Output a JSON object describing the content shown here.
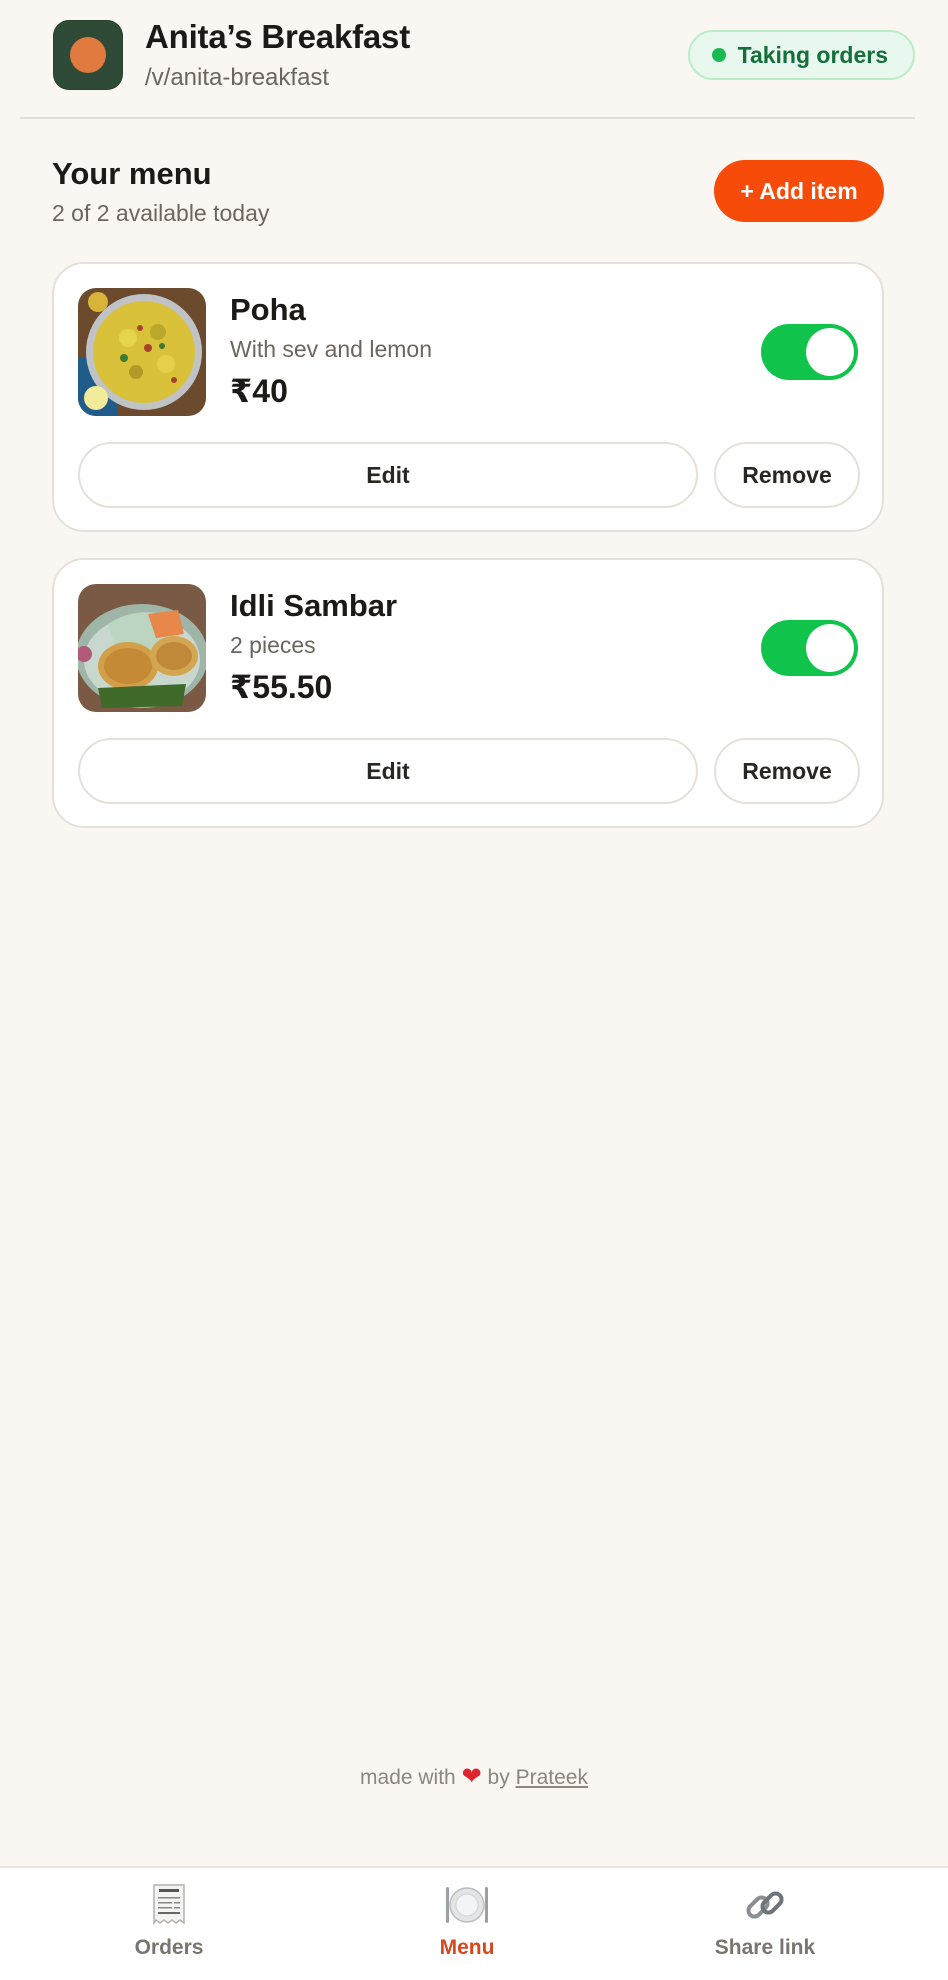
{
  "header": {
    "shop_name": "Anita’s Breakfast",
    "slug": "/v/anita-breakfast",
    "status_label": "Taking orders"
  },
  "menu": {
    "title": "Your menu",
    "subtitle": "2 of 2 available today",
    "add_label": "+ Add item",
    "items": [
      {
        "name": "Poha",
        "description": "With sev and lemon",
        "price": "₹40",
        "available": true,
        "image_icon": "poha-photo",
        "edit_label": "Edit",
        "remove_label": "Remove"
      },
      {
        "name": "Idli Sambar",
        "description": "2 pieces",
        "price": "₹55.50",
        "available": true,
        "image_icon": "idli-sambar-photo",
        "edit_label": "Edit",
        "remove_label": "Remove"
      }
    ]
  },
  "footer": {
    "credit_prefix": "made with",
    "credit_middle": "by",
    "credit_author": "Prateek"
  },
  "nav": {
    "items": [
      {
        "label": "Orders",
        "icon": "receipt-icon",
        "active": false
      },
      {
        "label": "Menu",
        "icon": "plate-icon",
        "active": true
      },
      {
        "label": "Share link",
        "icon": "link-icon",
        "active": false
      }
    ]
  },
  "colors": {
    "accent": "#f74b0a",
    "toggle_on": "#10c34b",
    "status_green": "#14703a",
    "background": "#faf7f2"
  }
}
